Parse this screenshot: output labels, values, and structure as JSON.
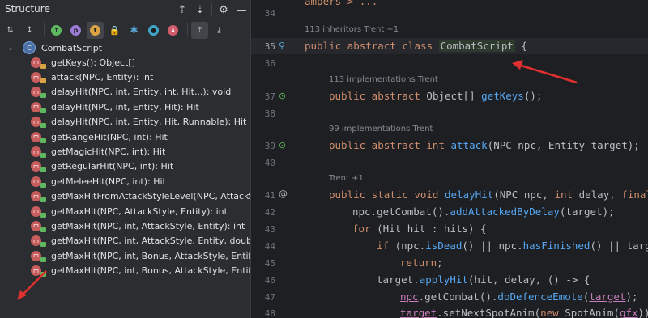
{
  "structure": {
    "title": "Structure",
    "root_label": "CombatScript",
    "items": [
      {
        "label": "getKeys(): Object[]",
        "badge": "m",
        "lock": "orange"
      },
      {
        "label": "attack(NPC, Entity): int",
        "badge": "m",
        "lock": "orange"
      },
      {
        "label": "delayHit(NPC, int, Entity, int, Hit...): void",
        "badge": "m",
        "lock": "green"
      },
      {
        "label": "delayHit(NPC, int, Entity, Hit): Hit",
        "badge": "m",
        "lock": "green"
      },
      {
        "label": "delayHit(NPC, int, Entity, Hit, Runnable): Hit",
        "badge": "m",
        "lock": "green"
      },
      {
        "label": "getRangeHit(NPC, int): Hit",
        "badge": "m",
        "lock": "green"
      },
      {
        "label": "getMagicHit(NPC, int): Hit",
        "badge": "m",
        "lock": "green"
      },
      {
        "label": "getRegularHit(NPC, int): Hit",
        "badge": "m",
        "lock": "green"
      },
      {
        "label": "getMeleeHit(NPC, int): Hit",
        "badge": "m",
        "lock": "green"
      },
      {
        "label": "getMaxHitFromAttackStyleLevel(NPC, AttackStyle",
        "badge": "m",
        "lock": "green"
      },
      {
        "label": "getMaxHit(NPC, AttackStyle, Entity): int",
        "badge": "m",
        "lock": "green"
      },
      {
        "label": "getMaxHit(NPC, int, AttackStyle, Entity): int",
        "badge": "m",
        "lock": "green"
      },
      {
        "label": "getMaxHit(NPC, int, AttackStyle, Entity, double):",
        "badge": "m",
        "lock": "green"
      },
      {
        "label": "getMaxHit(NPC, int, Bonus, AttackStyle, Entity): in",
        "badge": "m",
        "lock": "green"
      },
      {
        "label": "getMaxHit(NPC, int, Bonus, AttackStyle, Entity, do",
        "badge": "m",
        "lock": "green"
      }
    ],
    "toolbar_badges": [
      "p",
      "f",
      "λ"
    ],
    "colors": {
      "method": "#c75c5c",
      "public_lock": "#5fb760",
      "protected_lock": "#d9a343",
      "arrow": "#e03030"
    }
  },
  "editor": {
    "top_partial": "ampers > ...",
    "line_34": "34",
    "hint_35": "113 inheritors   Trent +1",
    "line_35": "35",
    "code_35_kw": "public abstract class ",
    "code_35_cls": "CombatScript",
    "code_35_end": " {",
    "line_36": "36",
    "hint_37": "113 implementations   Trent",
    "line_37": "37",
    "code_37_kw": "public abstract ",
    "code_37_type": "Object[] ",
    "code_37_fn": "getKeys",
    "code_37_end": "();",
    "line_38": "38",
    "hint_39": "99 implementations   Trent",
    "line_39": "39",
    "code_39_kw": "public abstract int ",
    "code_39_fn": "attack",
    "code_39_end": "(NPC npc, Entity target);",
    "line_40": "40",
    "hint_41": "Trent +1",
    "line_41": "41",
    "code_41_kw": "public static void ",
    "code_41_fn": "delayHit",
    "code_41_a": "(NPC npc, ",
    "code_41_kw2": "int ",
    "code_41_b": "delay, ",
    "code_41_kw3": "final",
    "line_42": "42",
    "code_42_a": "npc.getCombat().",
    "code_42_fn": "addAttackedByDelay",
    "code_42_b": "(target);",
    "line_43": "43",
    "code_43_kw": "for ",
    "code_43_a": "(Hit hit : hits) {",
    "line_44": "44",
    "code_44_kw": "if ",
    "code_44_a": "(npc.",
    "code_44_fn1": "isDead",
    "code_44_b": "() || npc.",
    "code_44_fn2": "hasFinished",
    "code_44_c": "() || targe",
    "line_45": "45",
    "code_45_kw": "return",
    "code_45_a": ";",
    "line_46": "46",
    "code_46_a": "target.",
    "code_46_fn": "applyHit",
    "code_46_b": "(hit, delay, () -> {",
    "line_47": "47",
    "code_47_a": "npc",
    "code_47_b": ".getCombat().",
    "code_47_fn": "doDefenceEmote",
    "code_47_c": "(",
    "code_47_d": "target",
    "code_47_e": ");",
    "line_48": "48",
    "code_48_a": "target",
    "code_48_b": ".setNextSpotAnim(",
    "code_48_kw": "new ",
    "code_48_c": "SpotAnim(",
    "code_48_d": "gfx",
    "code_48_e": "));"
  }
}
